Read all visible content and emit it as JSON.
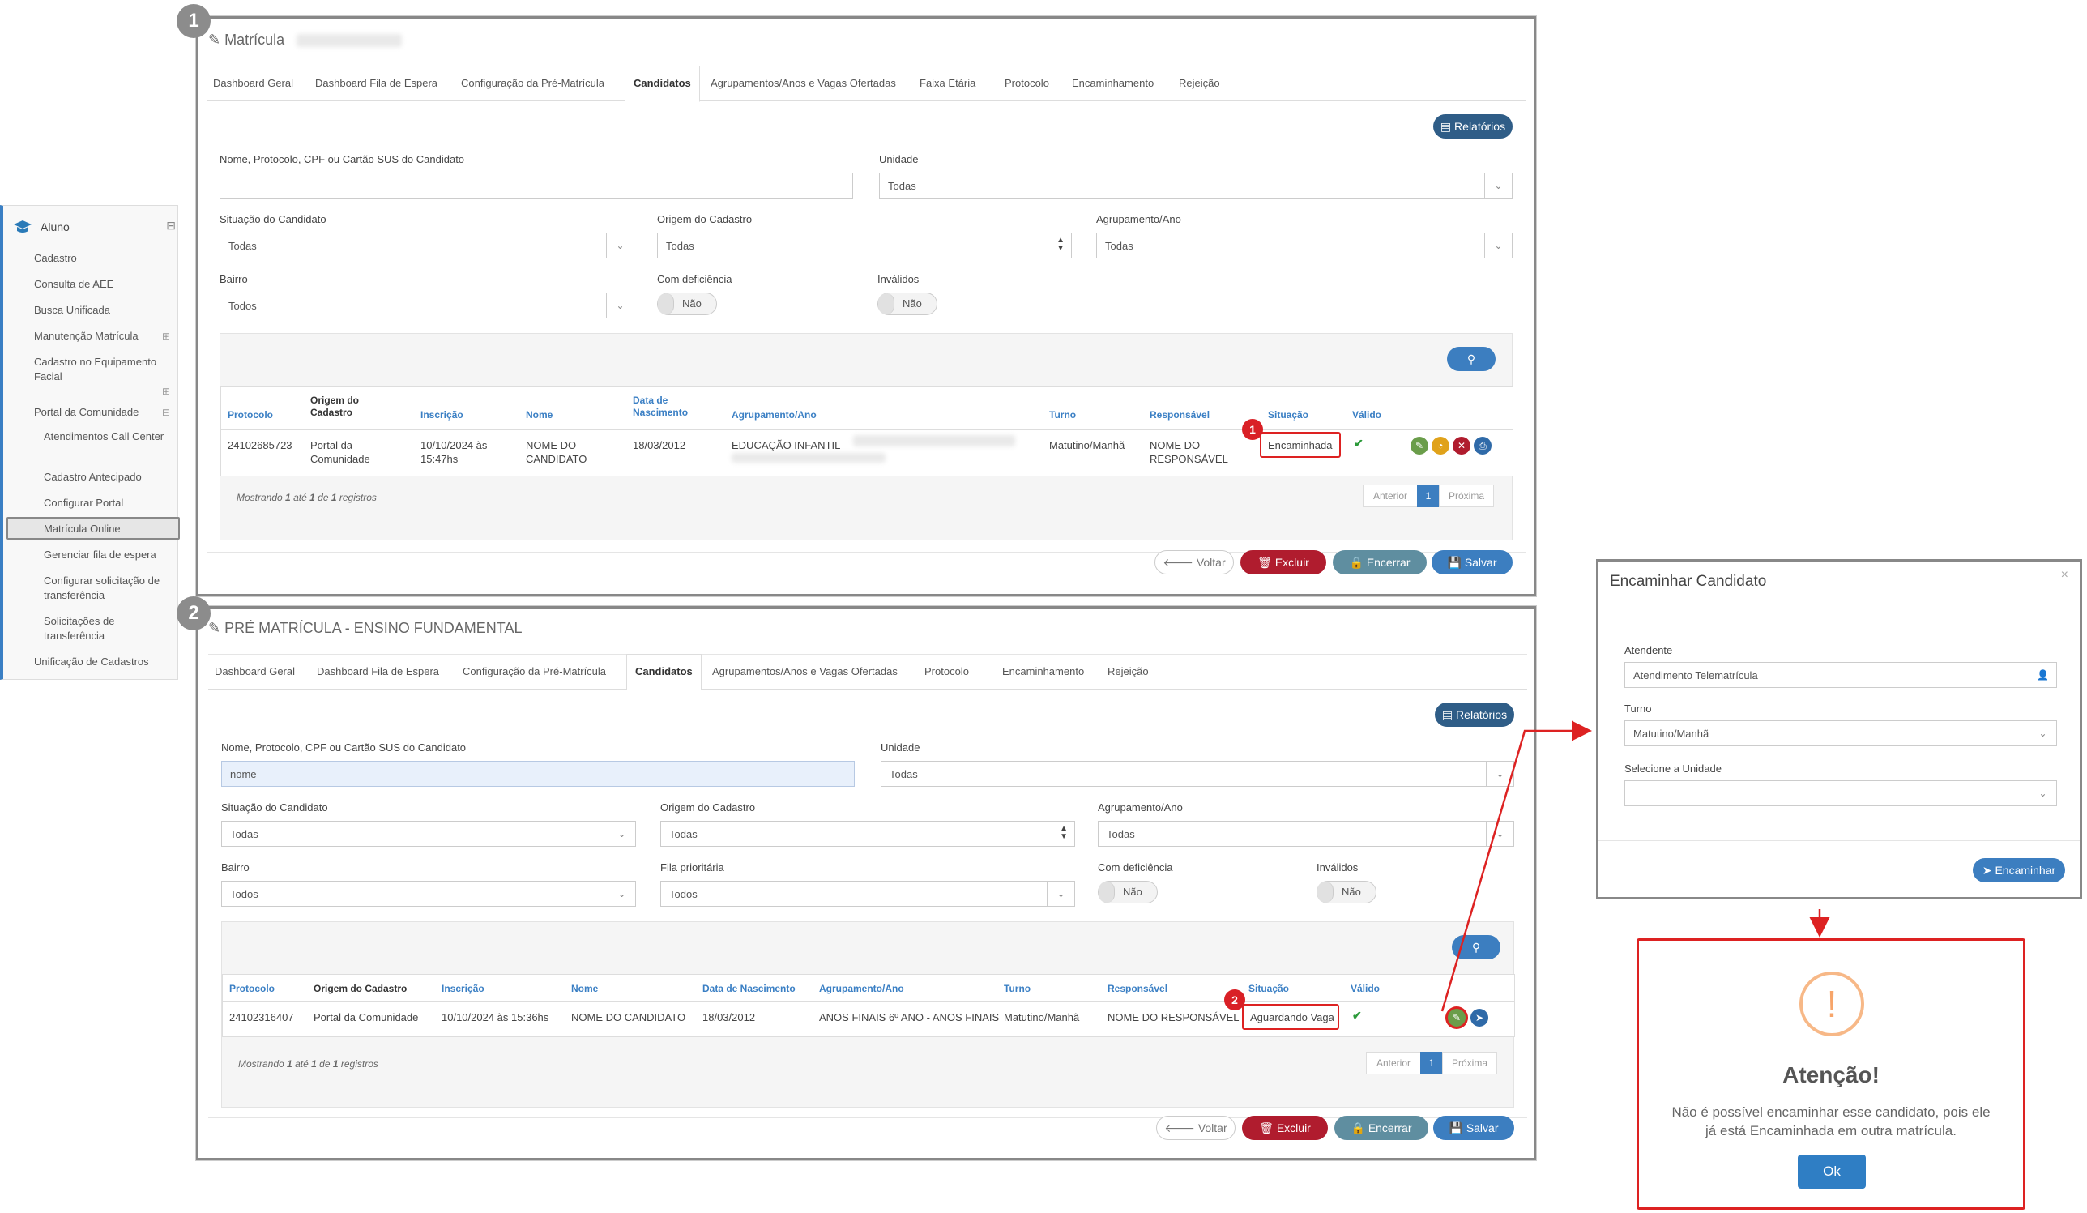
{
  "sidebar": {
    "module": "Aluno",
    "items": [
      "Cadastro",
      "Consulta de AEE",
      "Busca Unificada",
      "Manutenção Matrícula",
      "Cadastro no Equipamento Facial",
      "Portal da Comunidade"
    ],
    "subitems": [
      "Atendimentos Call Center",
      "Cadastro Antecipado",
      "Configurar Portal",
      "Matrícula Online",
      "Gerenciar fila de espera",
      "Configurar solicitação de transferência",
      "Solicitações de transferência"
    ],
    "last": "Unificação de Cadastros"
  },
  "panel1": {
    "step": "1",
    "title": "Matrícula",
    "tabs": [
      "Dashboard Geral",
      "Dashboard Fila de Espera",
      "Configuração da Pré-Matrícula",
      "Candidatos",
      "Agrupamentos/Anos e Vagas Ofertadas",
      "Faixa Etária",
      "Protocolo",
      "Encaminhamento",
      "Rejeição"
    ],
    "reports": "Relatórios",
    "labels": {
      "search": "Nome, Protocolo, CPF ou Cartão SUS do Candidato",
      "unit": "Unidade",
      "situation": "Situação do Candidato",
      "origin": "Origem do Cadastro",
      "group": "Agrupamento/Ano",
      "district": "Bairro",
      "disability": "Com deficiência",
      "invalid": "Inválidos"
    },
    "values": {
      "search": "",
      "unit": "Todas",
      "situation": "Todas",
      "origin": "Todas",
      "group": "Todas",
      "district": "Todos",
      "disability": "Não",
      "invalid": "Não"
    },
    "headers": [
      "Protocolo",
      "Origem do Cadastro",
      "Inscrição",
      "Nome",
      "Data de Nascimento",
      "Agrupamento/Ano",
      "Turno",
      "Responsável",
      "Situação",
      "Válido"
    ],
    "row": {
      "protocol": "24102685723",
      "origin": "Portal da Comunidade",
      "inscription": "10/10/2024 às 15:47hs",
      "name": "NOME DO CANDIDATO",
      "birth": "18/03/2012",
      "group": "EDUCAÇÃO INFANTIL",
      "shift": "Matutino/Manhã",
      "responsible": "NOME DO RESPONSÁVEL",
      "situation": "Encaminhada"
    },
    "badge": "1",
    "showing": {
      "pre": "Mostrando",
      "from": "1",
      "mid": "até",
      "to": "1",
      "of": "de",
      "total": "1",
      "post": "registros"
    },
    "pager": {
      "prev": "Anterior",
      "page": "1",
      "next": "Próxima"
    },
    "buttons": {
      "back": "Voltar",
      "delete": "Excluir",
      "close": "Encerrar",
      "save": "Salvar"
    }
  },
  "panel2": {
    "step": "2",
    "title": "PRÉ MATRÍCULA - ENSINO FUNDAMENTAL",
    "tabs": [
      "Dashboard Geral",
      "Dashboard Fila de Espera",
      "Configuração da Pré-Matrícula",
      "Candidatos",
      "Agrupamentos/Anos e Vagas Ofertadas",
      "Protocolo",
      "Encaminhamento",
      "Rejeição"
    ],
    "reports": "Relatórios",
    "labels": {
      "search": "Nome, Protocolo, CPF ou Cartão SUS do Candidato",
      "unit": "Unidade",
      "situation": "Situação do Candidato",
      "origin": "Origem do Cadastro",
      "group": "Agrupamento/Ano",
      "district": "Bairro",
      "priority": "Fila prioritária",
      "disability": "Com deficiência",
      "invalid": "Inválidos"
    },
    "values": {
      "search": "nome",
      "unit": "Todas",
      "situation": "Todas",
      "origin": "Todas",
      "group": "Todas",
      "district": "Todos",
      "priority": "Todos",
      "disability": "Não",
      "invalid": "Não"
    },
    "headers": [
      "Protocolo",
      "Origem do Cadastro",
      "Inscrição",
      "Nome",
      "Data de Nascimento",
      "Agrupamento/Ano",
      "Turno",
      "Responsável",
      "Situação",
      "Válido"
    ],
    "row": {
      "protocol": "24102316407",
      "origin": "Portal da Comunidade",
      "inscription": "10/10/2024 às 15:36hs",
      "name": "NOME DO CANDIDATO",
      "birth": "18/03/2012",
      "group": "ANOS FINAIS 6º ANO - ANOS FINAIS",
      "shift": "Matutino/Manhã",
      "responsible": "NOME DO RESPONSÁVEL",
      "situation": "Aguardando Vaga"
    },
    "badge": "2",
    "showing": {
      "pre": "Mostrando",
      "from": "1",
      "mid": "até",
      "to": "1",
      "of": "de",
      "total": "1",
      "post": "registros"
    },
    "pager": {
      "prev": "Anterior",
      "page": "1",
      "next": "Próxima"
    },
    "buttons": {
      "back": "Voltar",
      "delete": "Excluir",
      "close": "Encerrar",
      "save": "Salvar"
    }
  },
  "modal": {
    "title": "Encaminhar Candidato",
    "close": "×",
    "attendant_label": "Atendente",
    "attendant_value": "Atendimento Telematrícula",
    "shift_label": "Turno",
    "shift_value": "Matutino/Manhã",
    "unit_label": "Selecione a Unidade",
    "unit_value": "",
    "submit": "Encaminhar"
  },
  "alert": {
    "icon": "!",
    "title": "Atenção!",
    "message": "Não é possível encaminhar esse candidato, pois ele já está Encaminhada em outra matrícula.",
    "ok": "Ok"
  },
  "colors": {
    "primary": "#3c7ec0",
    "navy": "#2f5d87",
    "danger": "#b01c2e",
    "highlight": "#d22020"
  }
}
